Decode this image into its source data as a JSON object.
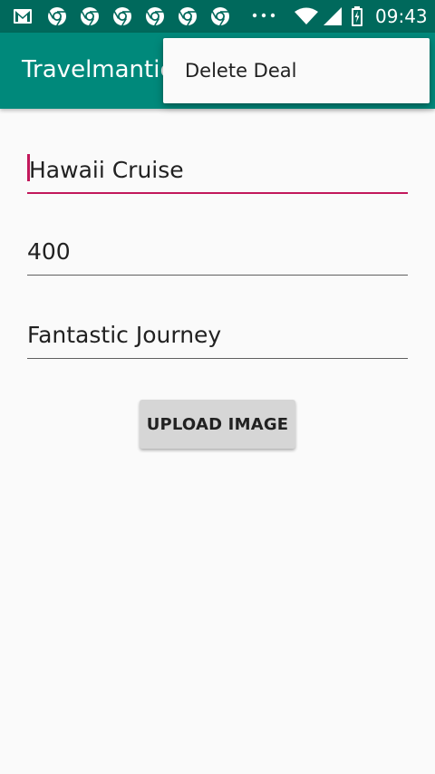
{
  "status_bar": {
    "time": "09:43",
    "icons": [
      "gmail-icon",
      "chrome-icon",
      "chrome-icon",
      "chrome-icon",
      "chrome-icon",
      "chrome-icon",
      "more-notifications-icon",
      "wifi-icon",
      "signal-icon",
      "battery-charging-icon"
    ]
  },
  "app_bar": {
    "title": "Travelmantics"
  },
  "overflow_menu": {
    "items": [
      {
        "label": "Delete Deal"
      }
    ]
  },
  "form": {
    "title_field": {
      "value": "Hawaii Cruise"
    },
    "price_field": {
      "value": "400"
    },
    "description_field": {
      "value": "Fantastic Journey"
    },
    "upload_button_label": "UPLOAD IMAGE"
  },
  "colors": {
    "status_bar": "#00695c",
    "app_bar": "#00897b",
    "accent": "#c2185b",
    "background": "#fafafa",
    "button": "#d6d6d6"
  }
}
